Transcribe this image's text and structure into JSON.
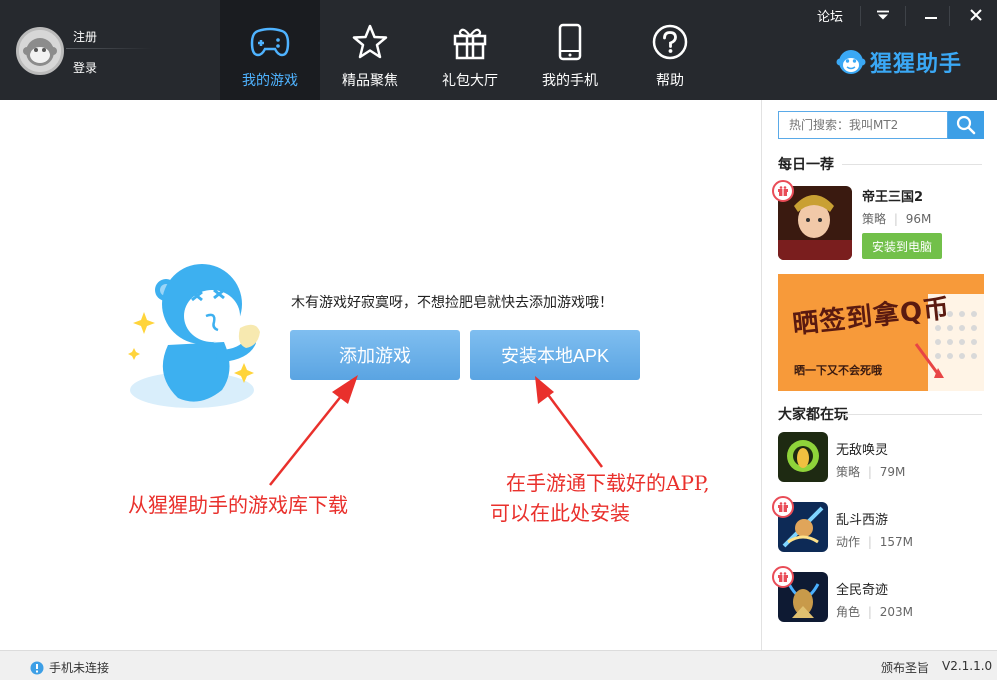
{
  "header": {
    "register_label": "注册",
    "login_label": "登录",
    "forum_label": "论坛",
    "brand_name": "猩猩助手",
    "brand_color": "#3aa8f5",
    "nav": [
      {
        "label": "我的游戏",
        "icon": "gamepad-icon",
        "active": true
      },
      {
        "label": "精品聚焦",
        "icon": "star-icon",
        "active": false
      },
      {
        "label": "礼包大厅",
        "icon": "gift-icon",
        "active": false
      },
      {
        "label": "我的手机",
        "icon": "phone-icon",
        "active": false
      },
      {
        "label": "帮助",
        "icon": "help-icon",
        "active": false
      }
    ]
  },
  "main": {
    "empty_message": "木有游戏好寂寞呀，不想捡肥皂就快去添加游戏哦！",
    "add_game_label": "添加游戏",
    "install_apk_label": "安装本地APK",
    "annotation_left": "从猩猩助手的游戏库下载",
    "annotation_right_line1": "在手游通下载好的APP,",
    "annotation_right_line2": "可以在此处安装",
    "annotation_color": "#e9302c"
  },
  "sidebar": {
    "search_placeholder": "热门搜索：我叫MT2",
    "daily_title": "每日一荐",
    "daily_game": {
      "name": "帝王三国2",
      "category": "策略",
      "size": "96M",
      "install_label": "安装到电脑"
    },
    "banner_text": "晒签到拿Q币",
    "banner_subtext": "晒一下又不会死哦",
    "popular_title": "大家都在玩",
    "popular_games": [
      {
        "name": "无敌唤灵",
        "category": "策略",
        "size": "79M"
      },
      {
        "name": "乱斗西游",
        "category": "动作",
        "size": "157M"
      },
      {
        "name": "全民奇迹",
        "category": "角色",
        "size": "203M"
      }
    ]
  },
  "status": {
    "phone_status": "手机未连接",
    "notice_label": "颁布圣旨",
    "version": "V2.1.1.0"
  }
}
